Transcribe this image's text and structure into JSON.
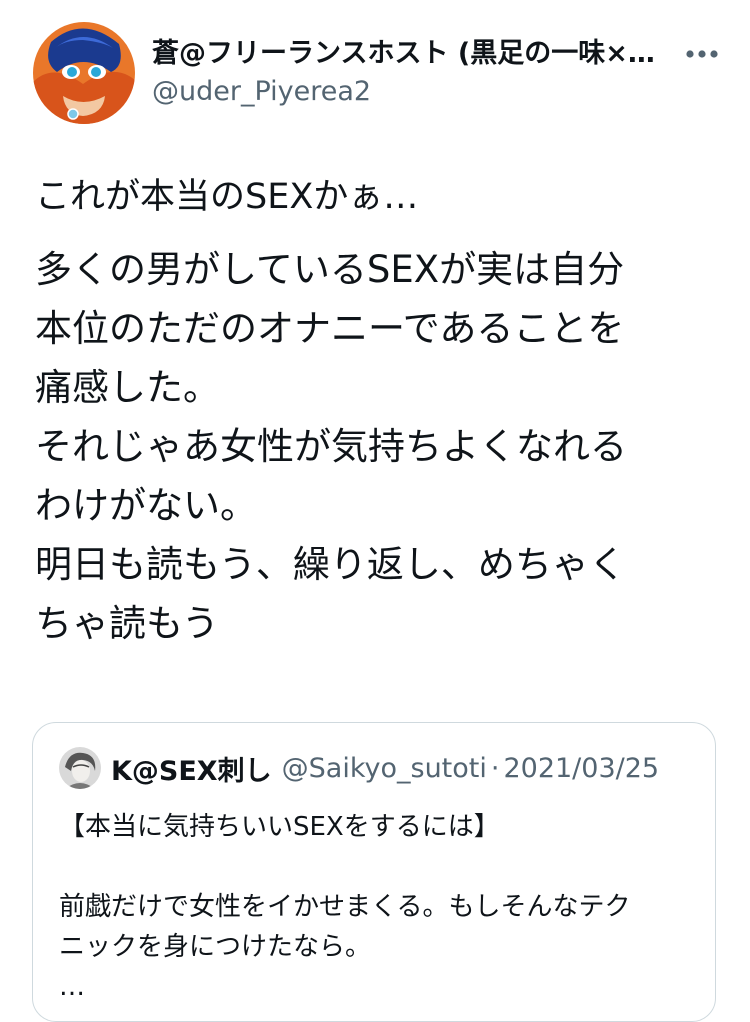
{
  "author": {
    "display_name": "蒼@フリーランスホスト (黒足の一味×…",
    "handle": "@uder_Piyerea2"
  },
  "more_icon": "more-horizontal-icon",
  "tweet": {
    "first_line": "これが本当のSEXかぁ…",
    "lines": [
      "多くの男がしているSEXが実は自分",
      "本位のただのオナニーであることを",
      "痛感した。",
      "それじゃあ女性が気持ちよくなれる",
      "わけがない。",
      "明日も読もう、繰り返し、めちゃく",
      "ちゃ読もう"
    ]
  },
  "quote": {
    "display_name": "K@SEX刺し",
    "handle": "@Saikyo_sutoti",
    "separator": "·",
    "date": "2021/03/25",
    "title": "【本当に気持ちいいSEXをするには】",
    "lines": [
      "前戯だけで女性をイかせまくる。もしそんなテク",
      "ニックを身につけたなら。",
      "…"
    ]
  },
  "colors": {
    "text": "#0f1419",
    "secondary": "#536471",
    "border": "#cfd9de"
  }
}
